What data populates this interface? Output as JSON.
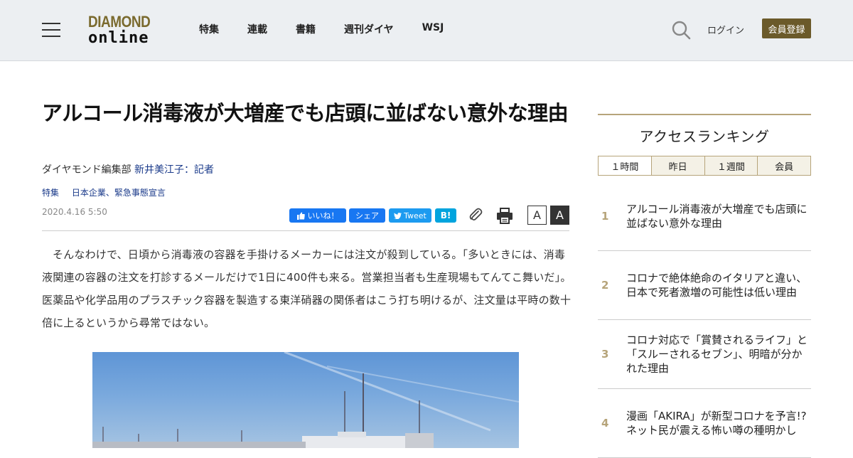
{
  "header": {
    "logo_line1": "DIAMOND",
    "logo_line2": "online",
    "nav": [
      "特集",
      "連載",
      "書籍",
      "週刊ダイヤ",
      "WSJ"
    ],
    "login_label": "ログイン",
    "register_label": "会員登録",
    "brand_color": "#6b5a2a"
  },
  "article": {
    "title": "アルコール消毒液が大増産でも店頭に並ばない意外な理由",
    "byline_dept": "ダイヤモンド編集部",
    "byline_author": "新井美江子：記者",
    "tags": [
      "特集",
      "日本企業、緊急事態宣言"
    ],
    "date": "2020.4.16 5:50",
    "share": {
      "like": "いいね！",
      "share": "シェア",
      "tweet": "Tweet",
      "hatena": "B!"
    },
    "font_small": "A",
    "font_large": "A",
    "body": "そんなわけで、日頃から消毒液の容器を手掛けるメーカーには注文が殺到している。「多いときには、消毒液関連の容器の注文を打診するメールだけで1日に400件も来る。営業担当者も生産現場もてんてこ舞いだ」。医薬品や化学品用のプラスチック容器を製造する東洋硝器の関係者はこう打ち明けるが、注文量は平時の数十倍に上るというから尋常ではない。"
  },
  "sidebar": {
    "title": "アクセスランキング",
    "tabs": [
      "１時間",
      "昨日",
      "１週間",
      "会員"
    ],
    "active_tab": "１時間",
    "ranking": [
      {
        "rank": "1",
        "title": "アルコール消毒液が大増産でも店頭に並ばない意外な理由"
      },
      {
        "rank": "2",
        "title": "コロナで絶体絶命のイタリアと違い、日本で死者激増の可能性は低い理由"
      },
      {
        "rank": "3",
        "title": "コロナ対応で「賞賛されるライフ」と「スルーされるセブン」、明暗が分かれた理由"
      },
      {
        "rank": "4",
        "title": "漫画「AKIRA」が新型コロナを予言!?ネット民が震える怖い噂の種明かし"
      }
    ]
  }
}
